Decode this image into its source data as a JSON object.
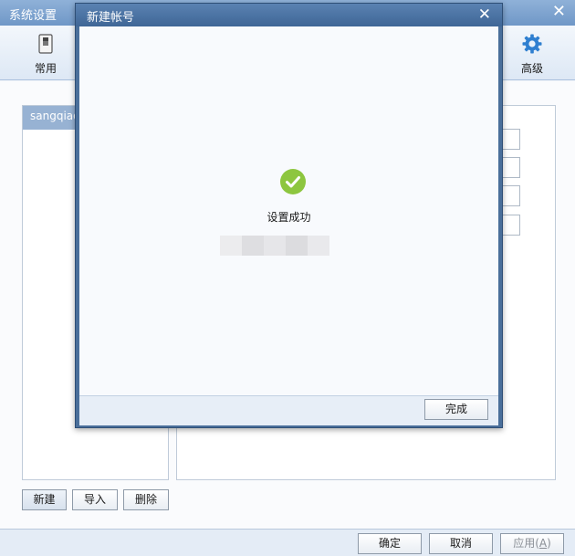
{
  "window": {
    "title": "系统设置"
  },
  "toolbar": {
    "general_label": "常用",
    "advanced_label": "高级"
  },
  "accounts": {
    "items": [
      {
        "label": "sangqiao"
      }
    ],
    "new_label": "新建",
    "import_label": "导入",
    "delete_label": "删除"
  },
  "footer": {
    "ok_label": "确定",
    "cancel_label": "取消",
    "apply_label": "应用",
    "apply_accel": "A"
  },
  "modal": {
    "title": "新建帐号",
    "success_text": "设置成功",
    "done_label": "完成"
  },
  "colors": {
    "success_green": "#8dc63f",
    "redact_light": "#ececee",
    "redact_dark": "#dcdcdf"
  }
}
